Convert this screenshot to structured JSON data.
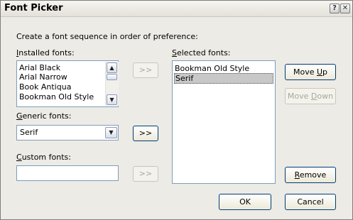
{
  "window": {
    "title": "Font Picker",
    "help_glyph": "?",
    "close_glyph": "✕"
  },
  "instructions": "Create a font sequence in order of preference:",
  "installed": {
    "label_accel": "I",
    "label_rest": "nstalled fonts:",
    "items": [
      "Arial Black",
      "Arial Narrow",
      "Book Antiqua",
      "Bookman Old Style"
    ]
  },
  "generic": {
    "label_accel": "G",
    "label_rest": "eneric fonts:",
    "value": "Serif"
  },
  "custom": {
    "label_accel": "C",
    "label_rest": "ustom fonts:",
    "value": ""
  },
  "selected": {
    "label_accel": "S",
    "label_rest": "elected fonts:",
    "items": [
      "Bookman Old Style",
      "Serif"
    ],
    "selected_index": 1
  },
  "buttons": {
    "add_installed": ">>",
    "add_generic": ">>",
    "add_custom": ">>",
    "move_up_pre": "Move ",
    "move_up_accel": "U",
    "move_up_post": "p",
    "move_down_pre": "Move ",
    "move_down_accel": "D",
    "move_down_post": "own",
    "remove_accel": "R",
    "remove_post": "emove",
    "ok": "OK",
    "cancel": "Cancel"
  },
  "icons": {
    "scroll_up": "▲",
    "scroll_down": "▼",
    "combo_arrow": "▼"
  }
}
